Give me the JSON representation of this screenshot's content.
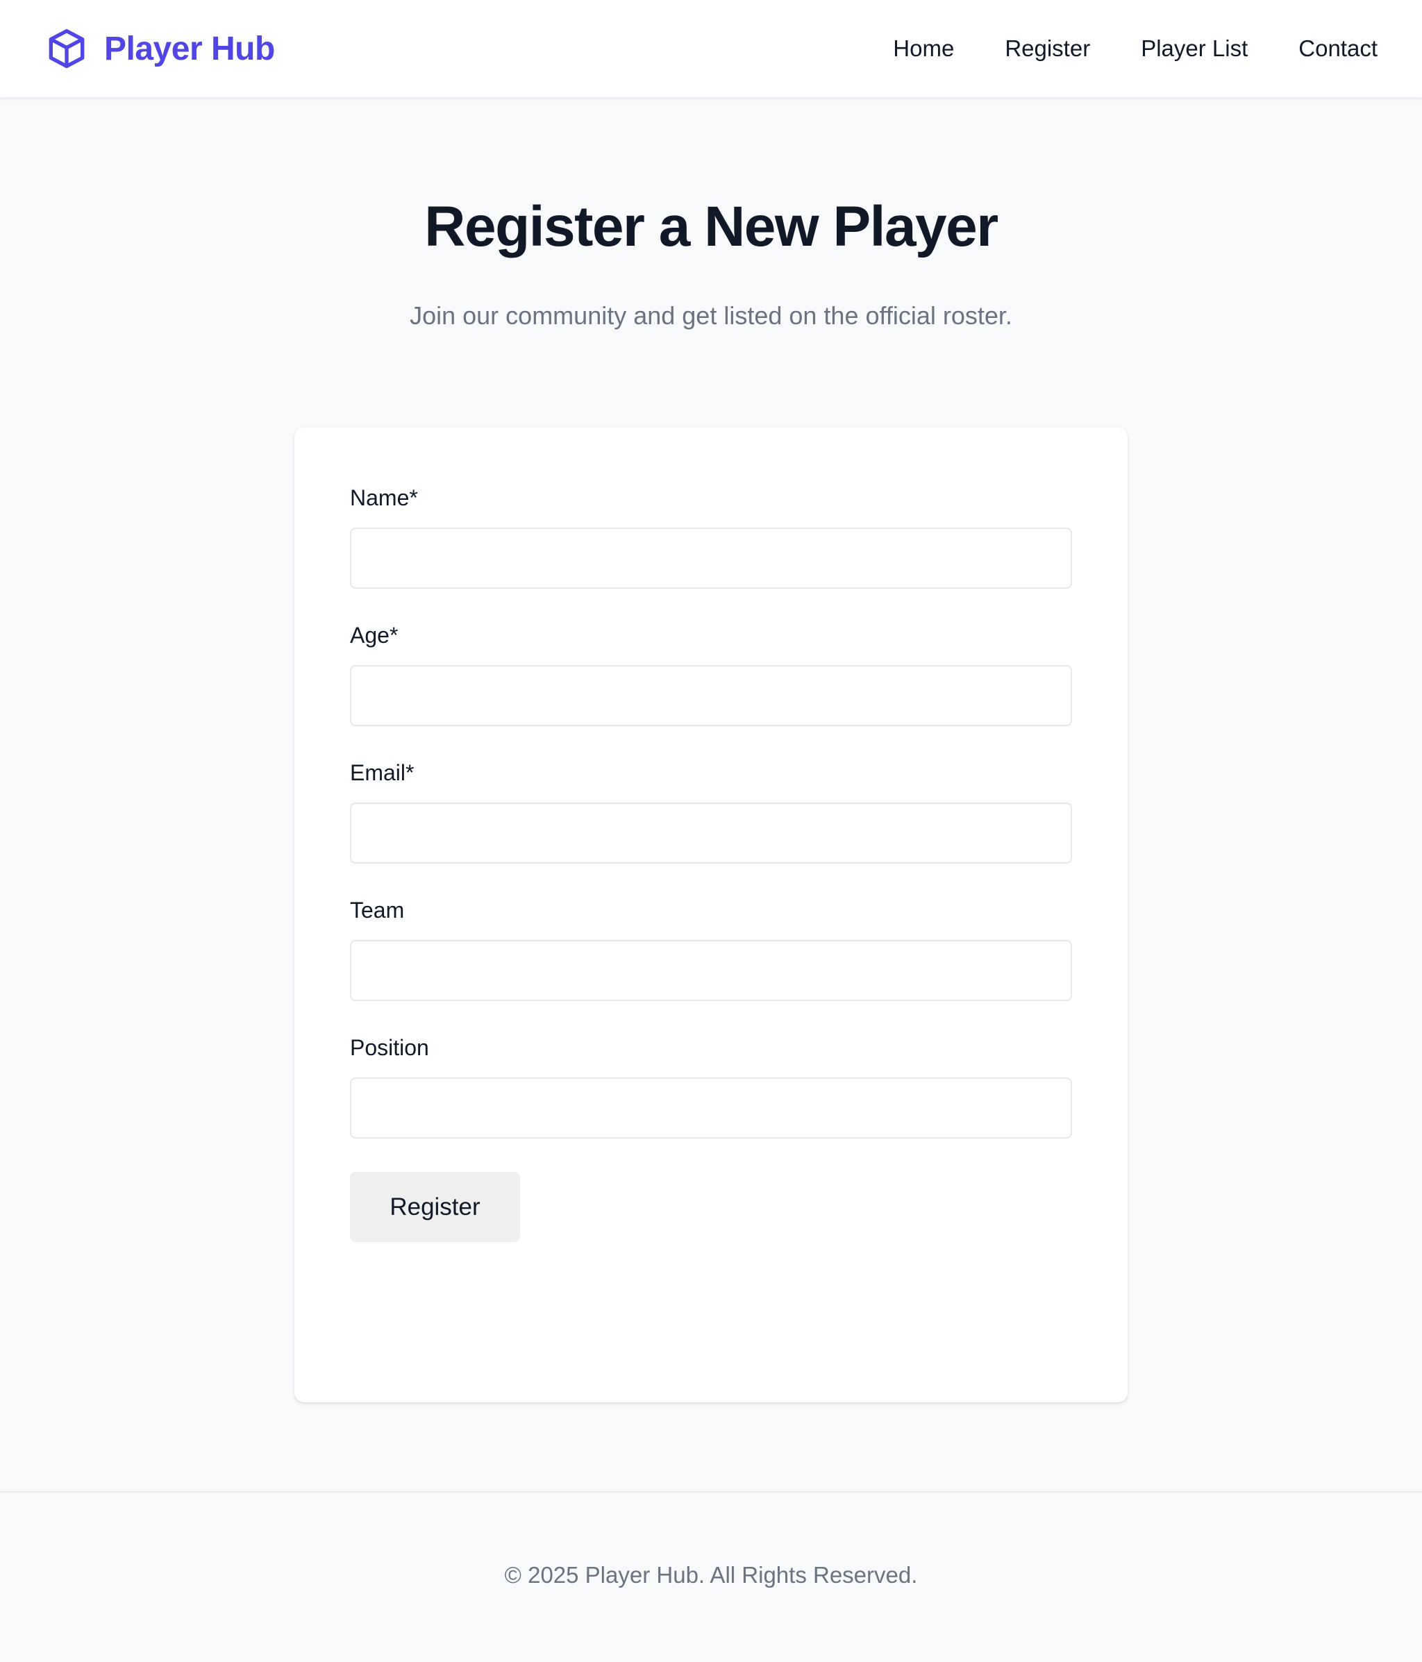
{
  "header": {
    "brand_name": "Player Hub",
    "brand_icon": "cube-icon",
    "nav": [
      {
        "label": "Home"
      },
      {
        "label": "Register"
      },
      {
        "label": "Player List"
      },
      {
        "label": "Contact"
      }
    ]
  },
  "hero": {
    "title": "Register a New Player",
    "subtitle": "Join our community and get listed on the official roster."
  },
  "form": {
    "fields": [
      {
        "label": "Name*",
        "value": "",
        "placeholder": ""
      },
      {
        "label": "Age*",
        "value": "",
        "placeholder": ""
      },
      {
        "label": "Email*",
        "value": "",
        "placeholder": ""
      },
      {
        "label": "Team",
        "value": "",
        "placeholder": ""
      },
      {
        "label": "Position",
        "value": "",
        "placeholder": ""
      }
    ],
    "submit_label": "Register"
  },
  "footer": {
    "copyright": "© 2025 Player Hub. All Rights Reserved."
  },
  "colors": {
    "brand": "#4f46e5",
    "page_background": "#f8f9fb",
    "text_primary": "#111827",
    "text_muted": "#6b7280"
  }
}
